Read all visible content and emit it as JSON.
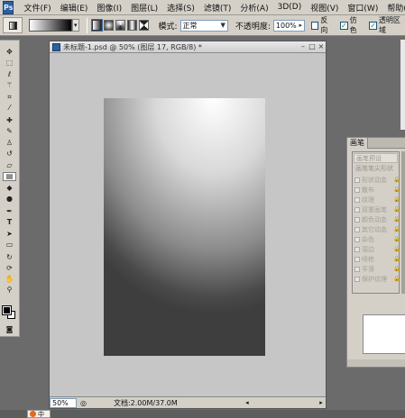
{
  "app": {
    "logo": "Ps",
    "menu": [
      "文件(F)",
      "编辑(E)",
      "图像(I)",
      "图层(L)",
      "选择(S)",
      "滤镜(T)",
      "分析(A)",
      "3D(D)",
      "视图(V)",
      "窗口(W)",
      "帮助(H)"
    ]
  },
  "options_bar": {
    "mode_label": "模式:",
    "mode_value": "正常",
    "opacity_label": "不透明度:",
    "opacity_value": "100%",
    "reverse_label": "反向",
    "dither_label": "仿色",
    "transparency_label": "透明区域",
    "reverse_checked": false,
    "dither_checked": true,
    "transparency_checked": true
  },
  "document": {
    "title": "未标题-1.psd @ 50% (图层 17, RGB/8) *",
    "zoom": "50%",
    "doc_size": "文档:2.00M/37.0M",
    "gradient_colors": [
      "#ffffff",
      "#3e3e3e"
    ]
  },
  "brush_panel": {
    "tab": "画笔",
    "preset_label": "画笔预设",
    "tip_shape_label": "画笔笔尖形状",
    "options": [
      "形状动态",
      "散布",
      "纹理",
      "双重画笔",
      "颜色动态",
      "其它动态",
      "杂色",
      "湿边",
      "喷枪",
      "平滑",
      "保护纹理"
    ]
  },
  "taskbar": {
    "ime_text": "中"
  }
}
